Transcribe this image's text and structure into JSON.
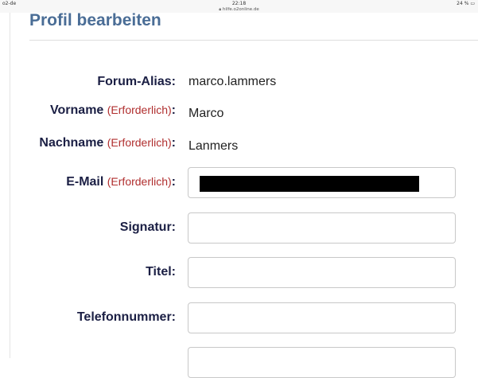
{
  "status_bar": {
    "carrier": "o2-de",
    "time": "22:18",
    "battery": "24 %"
  },
  "browser": {
    "url": "hilfe.o2online.de"
  },
  "page": {
    "title": "Profil bearbeiten"
  },
  "form": {
    "required_marker": "(Erforderlich)",
    "fields": {
      "forum_alias": {
        "label": "Forum-Alias:",
        "value": "marco.lammers"
      },
      "vorname": {
        "label": "Vorname",
        "value": "Marco"
      },
      "nachname": {
        "label": "Nachname",
        "value": "Lanmers"
      },
      "email": {
        "label": "E-Mail",
        "value": ""
      },
      "signatur": {
        "label": "Signatur:",
        "value": ""
      },
      "titel": {
        "label": "Titel:",
        "value": ""
      },
      "telefon": {
        "label": "Telefonnummer:",
        "value": ""
      }
    },
    "colon": ":"
  }
}
